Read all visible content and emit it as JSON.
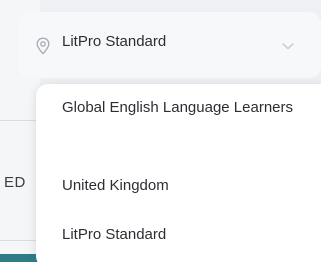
{
  "background": {
    "edge_text": "ED"
  },
  "select": {
    "value": "LitPro Standard",
    "icons": {
      "leading": "map-pin-icon",
      "trailing": "chevron-down-icon"
    }
  },
  "dropdown": {
    "options": [
      {
        "label": "Global English Language Learners"
      },
      {
        "label": "United Kingdom"
      },
      {
        "label": "LitPro Standard"
      }
    ]
  },
  "colors": {
    "accent": "#2e7d85",
    "text": "#2b2f33",
    "icon": "#a9afb6"
  }
}
